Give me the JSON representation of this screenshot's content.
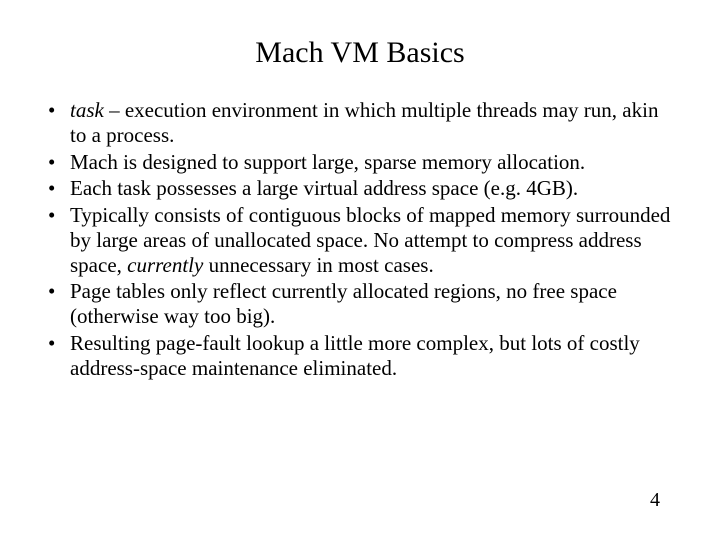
{
  "title": "Mach VM Basics",
  "bullets": {
    "b0": {
      "i0": "task",
      "t0": " – execution environment in which multiple threads may run, akin to a process."
    },
    "b1": "Mach is designed to support large, sparse memory allocation.",
    "b2": "Each task possesses a large virtual address space (e.g. 4GB).",
    "b3": {
      "pre": "Typically consists of contiguous blocks of mapped memory surrounded by large areas of unallocated space. No attempt to compress address space, ",
      "i": "currently",
      "post": " unnecessary in most cases."
    },
    "b4": "Page tables only reflect currently allocated regions, no free space (otherwise way too big).",
    "b5": "Resulting page-fault lookup a little more complex, but lots of costly address-space maintenance eliminated."
  },
  "page_number": "4"
}
